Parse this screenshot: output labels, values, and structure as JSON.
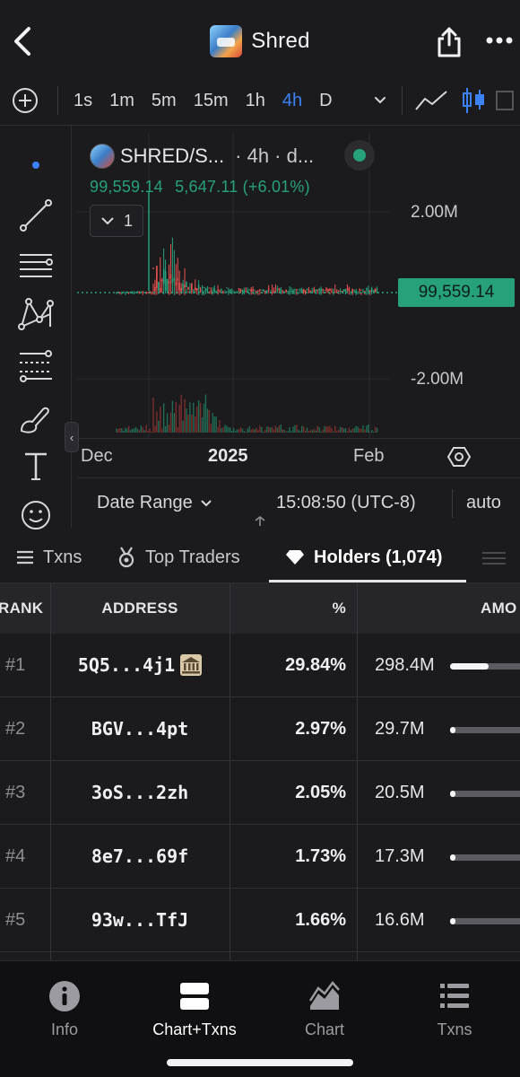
{
  "header": {
    "title": "Shred",
    "back_icon": "chevron-left-icon",
    "share_icon": "share-icon",
    "more_icon": "more-horizontal-icon"
  },
  "toolbar": {
    "intervals": [
      "1s",
      "1m",
      "5m",
      "15m",
      "1h",
      "4h",
      "D"
    ],
    "active_interval": "4h"
  },
  "chart": {
    "pair": "SHRED/S...",
    "meta": "· 4h · d...",
    "last_price": "99,559.14",
    "change": "5,647.11 (+6.01%)",
    "indicator_count": "1",
    "price_tag": "99,559.14",
    "y_labels": [
      "2.00M",
      "-2.00M"
    ],
    "x_labels": [
      "Dec",
      "2025",
      "Feb"
    ],
    "live_color": "#26a17b",
    "up_color": "#26a17b",
    "down_color": "#ef5350"
  },
  "range_bar": {
    "date_range_label": "Date Range",
    "clock": "15:08:50 (UTC-8)",
    "scale": "auto"
  },
  "tabs": [
    {
      "label": "Txns",
      "icon": "list-icon"
    },
    {
      "label": "Top Traders",
      "icon": "medal-icon"
    },
    {
      "label": "Holders (1,074)",
      "icon": "diamond-icon"
    }
  ],
  "active_tab": "Holders (1,074)",
  "table": {
    "headers": {
      "rank": "RANK",
      "address": "ADDRESS",
      "percent": "%",
      "amount": "AMO"
    },
    "rows": [
      {
        "rank": "#1",
        "address": "5Q5...4j1",
        "percent": "29.84%",
        "amount": "298.4M",
        "share": 0.2984,
        "badge": "bank-icon"
      },
      {
        "rank": "#2",
        "address": "BGV...4pt",
        "percent": "2.97%",
        "amount": "29.7M",
        "share": 0.0297
      },
      {
        "rank": "#3",
        "address": "3oS...2zh",
        "percent": "2.05%",
        "amount": "20.5M",
        "share": 0.0205
      },
      {
        "rank": "#4",
        "address": "8e7...69f",
        "percent": "1.73%",
        "amount": "17.3M",
        "share": 0.0173
      },
      {
        "rank": "#5",
        "address": "93w...TfJ",
        "percent": "1.66%",
        "amount": "16.6M",
        "share": 0.0166
      }
    ]
  },
  "bottom_nav": [
    {
      "label": "Info",
      "icon": "info-icon"
    },
    {
      "label": "Chart+Txns",
      "icon": "split-view-icon"
    },
    {
      "label": "Chart",
      "icon": "area-chart-icon"
    },
    {
      "label": "Txns",
      "icon": "list-icon"
    }
  ],
  "active_nav": "Chart+Txns"
}
